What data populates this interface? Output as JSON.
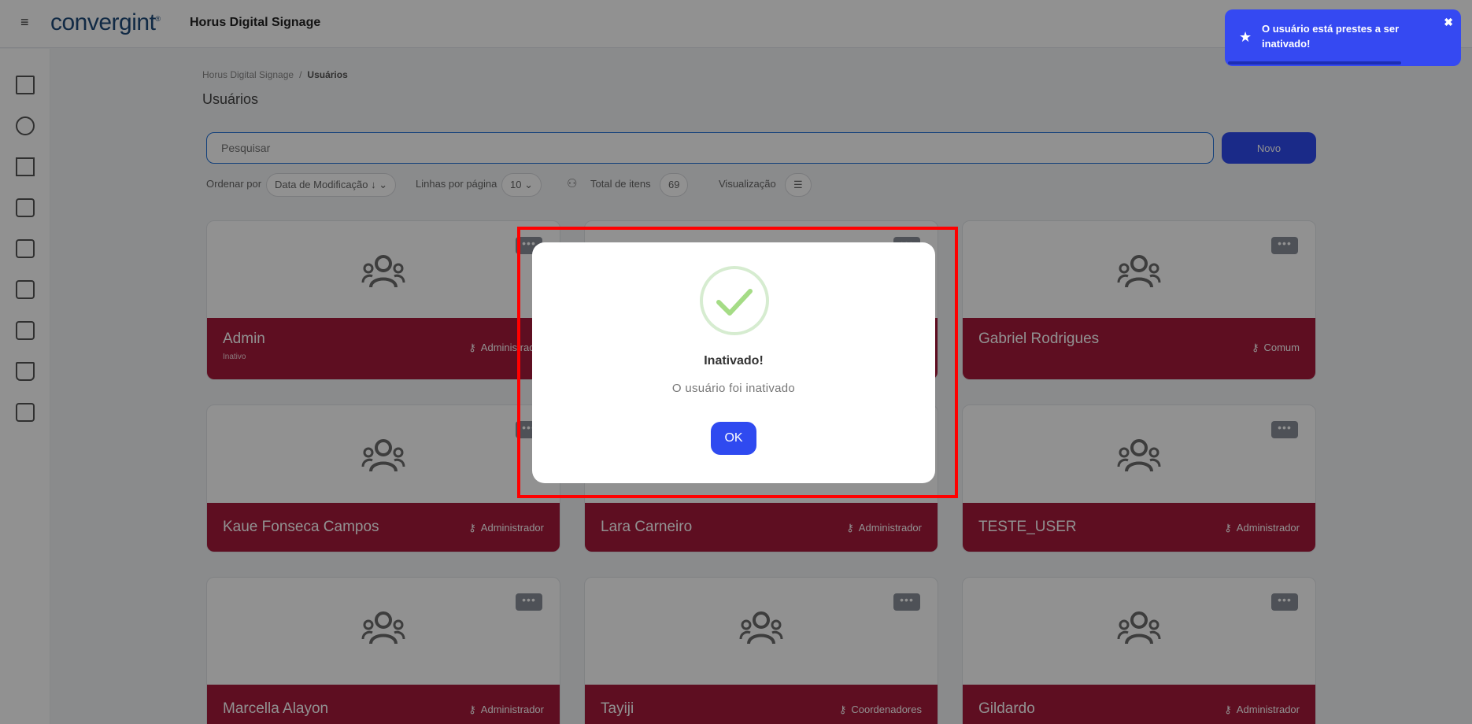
{
  "header": {
    "menu_icon": "hamburger-icon",
    "logo_text": "convergint",
    "app_title": "Horus Digital Signage"
  },
  "sidebar": {
    "icons": [
      "dashboard-icon",
      "hub-icon",
      "frame-icon",
      "layout-icon",
      "devices-icon",
      "screens-icon",
      "schedule-icon",
      "trash-icon",
      "copy-icon"
    ]
  },
  "breadcrumb": {
    "root": "Horus Digital Signage",
    "separator": "/",
    "current": "Usuários"
  },
  "page_title": "Usuários",
  "search": {
    "placeholder": "Pesquisar",
    "new_label": "Novo"
  },
  "filters": {
    "order_label": "Ordenar por",
    "order_value": "Data de Modificação ↓",
    "rows_label": "Linhas por página",
    "rows_value": "10",
    "total_label": "Total de itens",
    "total_value": "69",
    "view_label": "Visualização",
    "view_value": "☰"
  },
  "cards": [
    {
      "name": "Admin",
      "status": "Inativo",
      "role": "Administrador"
    },
    {
      "name": "",
      "status": "",
      "role": ""
    },
    {
      "name": "Gabriel Rodrigues",
      "status": "",
      "role": "Comum"
    },
    {
      "name": "Kaue Fonseca Campos",
      "status": "",
      "role": "Administrador"
    },
    {
      "name": "Lara Carneiro",
      "status": "",
      "role": "Administrador"
    },
    {
      "name": "TESTE_USER",
      "status": "",
      "role": "Administrador"
    },
    {
      "name": "Marcella Alayon",
      "status": "",
      "role": "Administrador"
    },
    {
      "name": "Tayiji",
      "status": "",
      "role": "Coordenadores"
    },
    {
      "name": "Gildardo",
      "status": "",
      "role": "Administrador"
    }
  ],
  "card_more_label": "•••",
  "modal": {
    "title": "Inativado!",
    "text": "O usuário foi inativado",
    "ok_label": "OK",
    "icon": "success-check-icon"
  },
  "toast": {
    "text": "O usuário está prestes a ser inativado!",
    "icon": "star-icon",
    "close": "✖"
  },
  "colors": {
    "accent": "#2f4af0",
    "card_footer": "#a6193a",
    "highlight": "#ff0000"
  }
}
